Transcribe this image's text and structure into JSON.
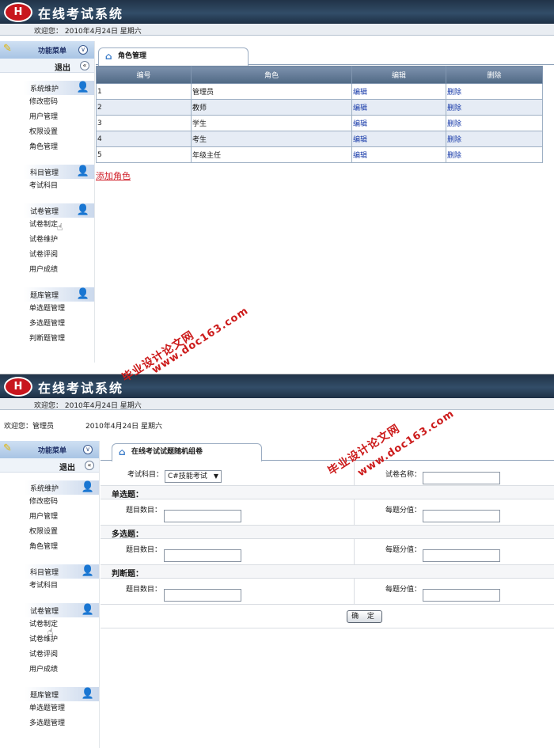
{
  "app": {
    "title": "在线考试系统",
    "logo_letter": "H",
    "welcome": "欢迎您：  2010年4月24日  星期六"
  },
  "sidebar": {
    "menu_title": "功能菜单",
    "logout": "退出",
    "groups": [
      {
        "title": "系统维护",
        "items": [
          "修改密码",
          "用户管理",
          "权限设置",
          "角色管理"
        ]
      },
      {
        "title": "科目管理",
        "items": [
          "考试科目"
        ]
      },
      {
        "title": "试卷管理",
        "items": [
          "试卷制定",
          "试卷维护",
          "试卷评阅",
          "用户成绩"
        ]
      },
      {
        "title": "题库管理",
        "items": [
          "单选题管理",
          "多选题管理",
          "判断题管理"
        ]
      }
    ]
  },
  "role_page": {
    "tab": "角色管理",
    "columns": [
      "编号",
      "角色",
      "编辑",
      "删除"
    ],
    "rows": [
      {
        "id": "1",
        "role": "管理员",
        "edit": "编辑",
        "del": "删除"
      },
      {
        "id": "2",
        "role": "教师",
        "edit": "编辑",
        "del": "删除"
      },
      {
        "id": "3",
        "role": "学生",
        "edit": "编辑",
        "del": "删除"
      },
      {
        "id": "4",
        "role": "考生",
        "edit": "编辑",
        "del": "删除"
      },
      {
        "id": "5",
        "role": "年级主任",
        "edit": "编辑",
        "del": "删除"
      }
    ],
    "add_link": "添加角色"
  },
  "exam_page": {
    "user_bar": {
      "user": "欢迎您：管理员",
      "date": "2010年4月24日  星期六"
    },
    "tab": "在线考试试题随机组卷",
    "subject_label": "考试科目：",
    "subject_value": "C#技能考试",
    "paper_name_label": "试卷名称：",
    "sections": [
      "单选题：",
      "多选题：",
      "判断题："
    ],
    "count_label": "题目数目：",
    "score_label": "每题分值：",
    "confirm": "确 定"
  },
  "watermark": {
    "text1": "毕业设计论文网",
    "text2": "www.doc163.com"
  },
  "colors": {
    "header": "#213348",
    "accent_red": "#cc1b1b",
    "table_header": "#506985",
    "link": "#1538a8"
  }
}
